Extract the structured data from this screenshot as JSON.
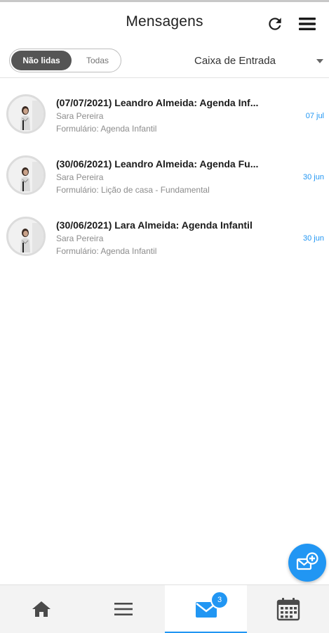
{
  "header": {
    "title": "Mensagens",
    "icons": [
      "refresh-icon",
      "hamburger-menu-icon"
    ]
  },
  "filter": {
    "segments": [
      "Não lidas",
      "Todas"
    ],
    "selected": "Não lidas",
    "mailbox": "Caixa de Entrada"
  },
  "messages": [
    {
      "title": "(07/07/2021) Leandro Almeida: Agenda Inf...",
      "sender": "Sara Pereira",
      "form": "Formulário: Agenda Infantil",
      "date": "07 jul"
    },
    {
      "title": "(30/06/2021) Leandro Almeida: Agenda Fu...",
      "sender": "Sara Pereira",
      "form": "Formulário: Lição de casa - Fundamental",
      "date": "30 jun"
    },
    {
      "title": "(30/06/2021) Lara Almeida: Agenda Infantil",
      "sender": "Sara Pereira",
      "form": "Formulário: Agenda Infantil",
      "date": "30 jun"
    }
  ],
  "bottom_nav": {
    "items": [
      "home-icon",
      "list-icon",
      "mail-icon",
      "calendar-icon"
    ],
    "active": "mail-icon",
    "badge_count": "3"
  },
  "colors": {
    "accent": "#2196f3",
    "toggle_active": "#555555",
    "text_secondary": "#8c8c8c"
  }
}
